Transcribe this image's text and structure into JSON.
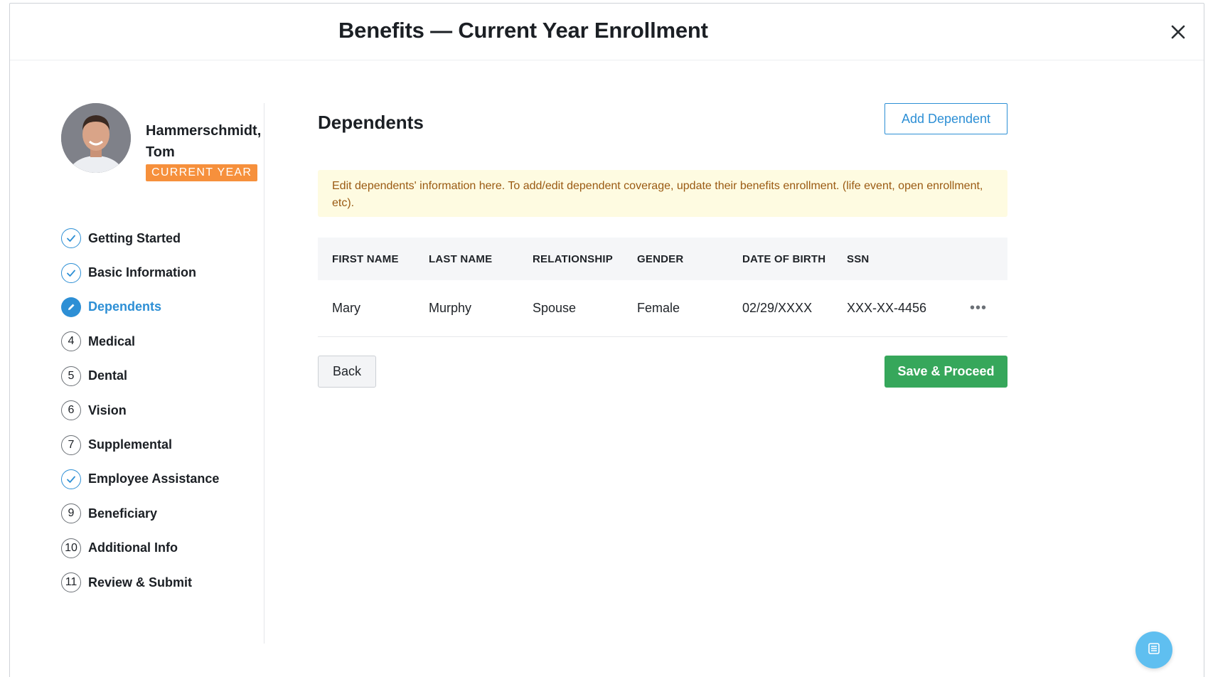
{
  "modal": {
    "title": "Benefits — Current Year Enrollment",
    "close_icon": "close-icon"
  },
  "employee": {
    "name_line1": "Hammerschmidt,",
    "name_line2": "Tom",
    "badge": "CURRENT YEAR"
  },
  "steps": [
    {
      "label": "Getting Started",
      "state": "done",
      "marker": ""
    },
    {
      "label": "Basic Information",
      "state": "done",
      "marker": ""
    },
    {
      "label": "Dependents",
      "state": "active",
      "marker": ""
    },
    {
      "label": "Medical",
      "state": "pending",
      "marker": "4"
    },
    {
      "label": "Dental",
      "state": "pending",
      "marker": "5"
    },
    {
      "label": "Vision",
      "state": "pending",
      "marker": "6"
    },
    {
      "label": "Supplemental",
      "state": "pending",
      "marker": "7"
    },
    {
      "label": "Employee Assistance",
      "state": "done",
      "marker": ""
    },
    {
      "label": "Beneficiary",
      "state": "pending",
      "marker": "9"
    },
    {
      "label": "Additional Info",
      "state": "pending",
      "marker": "10"
    },
    {
      "label": "Review & Submit",
      "state": "pending",
      "marker": "11"
    }
  ],
  "main": {
    "section_title": "Dependents",
    "add_button": "Add Dependent",
    "notice": "Edit dependents' information here. To add/edit dependent coverage, update their benefits enrollment. (life event, open enrollment, etc).",
    "table": {
      "headers": [
        "FIRST NAME",
        "LAST NAME",
        "RELATIONSHIP",
        "GENDER",
        "DATE OF BIRTH",
        "SSN"
      ],
      "rows": [
        {
          "first": "Mary",
          "last": "Murphy",
          "relationship": "Spouse",
          "gender": "Female",
          "dob": "02/29/XXXX",
          "ssn": "XXX-XX-4456",
          "menu": "•••"
        }
      ]
    },
    "back_button": "Back",
    "save_button": "Save & Proceed"
  },
  "colors": {
    "accent": "#2d8fd5",
    "badge": "#f6903c",
    "success": "#36a75b",
    "notice_bg": "#fefbe1",
    "notice_text": "#9a5a12"
  }
}
